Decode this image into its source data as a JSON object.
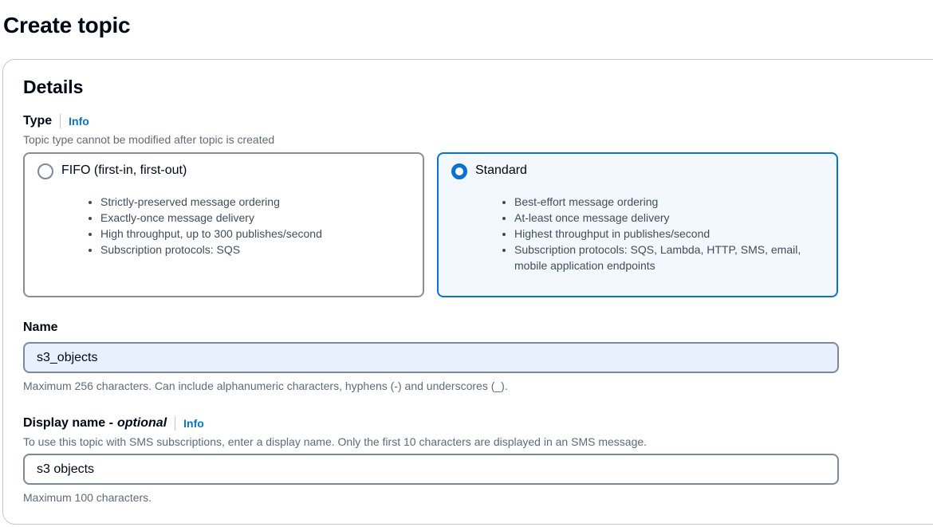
{
  "page": {
    "title": "Create topic"
  },
  "details": {
    "title": "Details",
    "type": {
      "label": "Type",
      "info": "Info",
      "description": "Topic type cannot be modified after topic is created",
      "options": [
        {
          "title": "FIFO (first-in, first-out)",
          "selected": false,
          "bullets": [
            "Strictly-preserved message ordering",
            "Exactly-once message delivery",
            "High throughput, up to 300 publishes/second",
            "Subscription protocols: SQS"
          ]
        },
        {
          "title": "Standard",
          "selected": true,
          "bullets": [
            "Best-effort message ordering",
            "At-least once message delivery",
            "Highest throughput in publishes/second",
            "Subscription protocols: SQS, Lambda, HTTP, SMS, email, mobile application endpoints"
          ]
        }
      ]
    },
    "name": {
      "label": "Name",
      "value": "s3_objects",
      "hint": "Maximum 256 characters. Can include alphanumeric characters, hyphens (-) and underscores (_)."
    },
    "display_name": {
      "label": "Display name -",
      "optional": "optional",
      "info": "Info",
      "description": "To use this topic with SMS subscriptions, enter a display name. Only the first 10 characters are displayed in an SMS message.",
      "value": "s3 objects",
      "hint": "Maximum 100 characters."
    }
  },
  "colors": {
    "accent": "#0972d3",
    "selected_tile_bg": "#f2f8fd",
    "autofill_bg": "#e8f0fe"
  }
}
